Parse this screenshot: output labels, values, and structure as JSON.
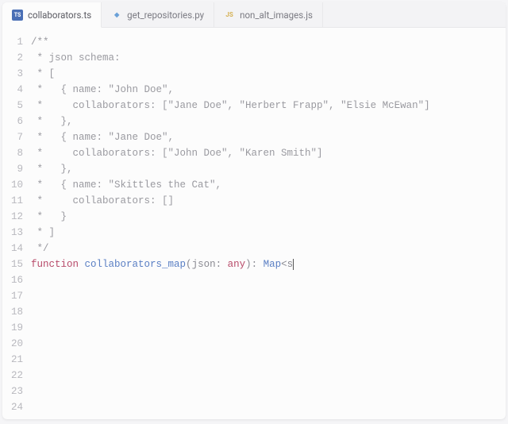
{
  "tabs": [
    {
      "label": "collaborators.ts",
      "icon": "TS",
      "active": true
    },
    {
      "label": "get_repositories.py",
      "icon": "◆",
      "active": false
    },
    {
      "label": "non_alt_images.js",
      "icon": "JS",
      "active": false
    }
  ],
  "lines": [
    {
      "n": 1,
      "t": "comment",
      "text": "/**"
    },
    {
      "n": 2,
      "t": "comment",
      "text": " * json schema:"
    },
    {
      "n": 3,
      "t": "comment",
      "text": " * ["
    },
    {
      "n": 4,
      "t": "comment",
      "text": " *   { name: \"John Doe\","
    },
    {
      "n": 5,
      "t": "comment",
      "text": " *     collaborators: [\"Jane Doe\", \"Herbert Frapp\", \"Elsie McEwan\"]"
    },
    {
      "n": 6,
      "t": "comment",
      "text": " *   },"
    },
    {
      "n": 7,
      "t": "comment",
      "text": " *   { name: \"Jane Doe\","
    },
    {
      "n": 8,
      "t": "comment",
      "text": " *     collaborators: [\"John Doe\", \"Karen Smith\"]"
    },
    {
      "n": 9,
      "t": "comment",
      "text": " *   },"
    },
    {
      "n": 10,
      "t": "comment",
      "text": " *   { name: \"Skittles the Cat\","
    },
    {
      "n": 11,
      "t": "comment",
      "text": " *     collaborators: []"
    },
    {
      "n": 12,
      "t": "comment",
      "text": " *   }"
    },
    {
      "n": 13,
      "t": "comment",
      "text": " * ]"
    },
    {
      "n": 14,
      "t": "comment",
      "text": " */"
    },
    {
      "n": 15,
      "t": "code",
      "tokens": [
        {
          "cls": "tok-keyword",
          "text": "function "
        },
        {
          "cls": "tok-func",
          "text": "collaborators_map"
        },
        {
          "cls": "tok-punct",
          "text": "("
        },
        {
          "cls": "tok-param",
          "text": "json"
        },
        {
          "cls": "tok-punct",
          "text": ": "
        },
        {
          "cls": "tok-keyword",
          "text": "any"
        },
        {
          "cls": "tok-punct",
          "text": "): "
        },
        {
          "cls": "tok-type",
          "text": "Map"
        },
        {
          "cls": "tok-punct",
          "text": "<"
        },
        {
          "cls": "tok-param",
          "text": "s"
        }
      ]
    },
    {
      "n": 16,
      "t": "empty",
      "text": ""
    },
    {
      "n": 17,
      "t": "empty",
      "text": ""
    },
    {
      "n": 18,
      "t": "empty",
      "text": ""
    },
    {
      "n": 19,
      "t": "empty",
      "text": ""
    },
    {
      "n": 20,
      "t": "empty",
      "text": ""
    },
    {
      "n": 21,
      "t": "empty",
      "text": ""
    },
    {
      "n": 22,
      "t": "empty",
      "text": ""
    },
    {
      "n": 23,
      "t": "empty",
      "text": ""
    },
    {
      "n": 24,
      "t": "empty",
      "text": ""
    }
  ]
}
